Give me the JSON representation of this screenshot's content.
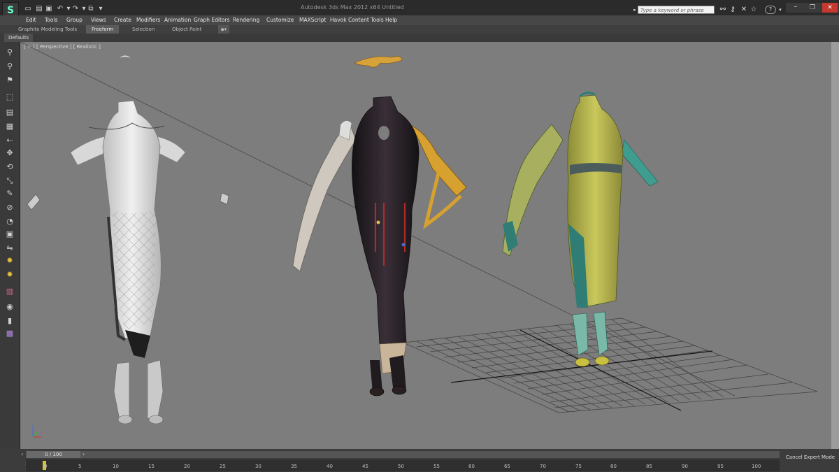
{
  "title_bar": {
    "app_logo": "S",
    "window_title": "Autodesk 3ds Max  2012 x64      Untitled",
    "search_placeholder": "Type a keyword or phrase",
    "help_label": "?"
  },
  "menu": [
    "Edit",
    "Tools",
    "Group",
    "Views",
    "Create",
    "Modifiers",
    "Animation",
    "Graph Editors",
    "Rendering",
    "Customize",
    "MAXScript",
    "Havok Content Tools",
    "Help"
  ],
  "ribbon": {
    "tabs": [
      "Graphite Modeling Tools",
      "Freeform",
      "Selection",
      "Object Paint"
    ],
    "active_tab": "Freeform",
    "defaults_label": "Defaults"
  },
  "viewport": {
    "label": "[ + ] [ Perspective ] [ Realistic ]"
  },
  "timeline": {
    "slider_label": "0 / 100",
    "ticks": [
      "0",
      "5",
      "10",
      "15",
      "20",
      "25",
      "30",
      "35",
      "40",
      "45",
      "50",
      "55",
      "60",
      "65",
      "70",
      "75",
      "80",
      "85",
      "90",
      "95",
      "100"
    ],
    "cancel_expert_label": "Cancel Expert Mode"
  },
  "colors": {
    "viewport_bg": "#7d7d7d",
    "ui_dark": "#3a3a3a",
    "dress_white": "#e4e4e4",
    "dress_black": "#262226",
    "dress_green": "#b2b24a",
    "accent_teal": "#4a9a8a"
  }
}
